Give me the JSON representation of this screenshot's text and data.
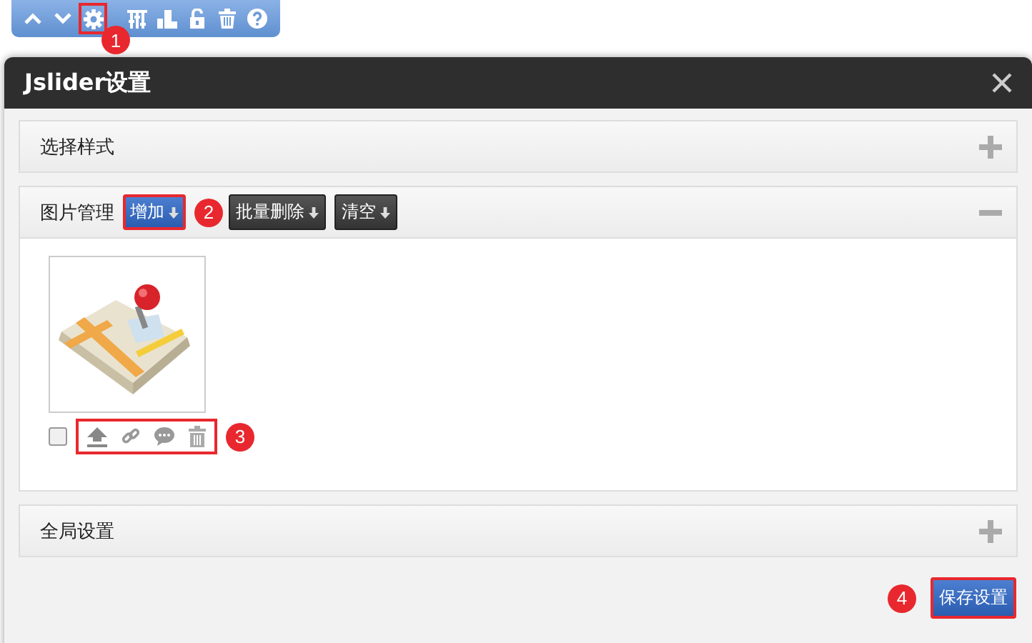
{
  "toolbar": {
    "buttons": [
      {
        "kind": "up",
        "highlighted": false
      },
      {
        "kind": "down",
        "highlighted": false
      },
      {
        "kind": "settings",
        "highlighted": true,
        "callout": "1"
      },
      {
        "kind": "sliders",
        "highlighted": false
      },
      {
        "kind": "chart",
        "highlighted": false
      },
      {
        "kind": "unlock",
        "highlighted": false
      },
      {
        "kind": "trash",
        "highlighted": false
      },
      {
        "kind": "help",
        "highlighted": false
      }
    ]
  },
  "dialog": {
    "title": "Jslider设置",
    "sections": [
      {
        "title": "选择样式",
        "expanded": false
      },
      {
        "title": "图片管理",
        "expanded": true,
        "actions": [
          {
            "label": "增加",
            "highlighted": true,
            "callout": "2"
          },
          {
            "label": "批量删除",
            "highlighted": false
          },
          {
            "label": "清空",
            "highlighted": false
          }
        ],
        "images": [
          {
            "kind": "picture",
            "checked": false,
            "tools_highlighted": true,
            "callout": "3",
            "tools": [
              {
                "kind": "upload"
              },
              {
                "kind": "link"
              },
              {
                "kind": "comment"
              },
              {
                "kind": "trash"
              }
            ]
          }
        ]
      },
      {
        "title": "全局设置",
        "expanded": false
      }
    ],
    "save_button": {
      "label": "保存设置",
      "highlighted": true,
      "callout": "4"
    }
  }
}
